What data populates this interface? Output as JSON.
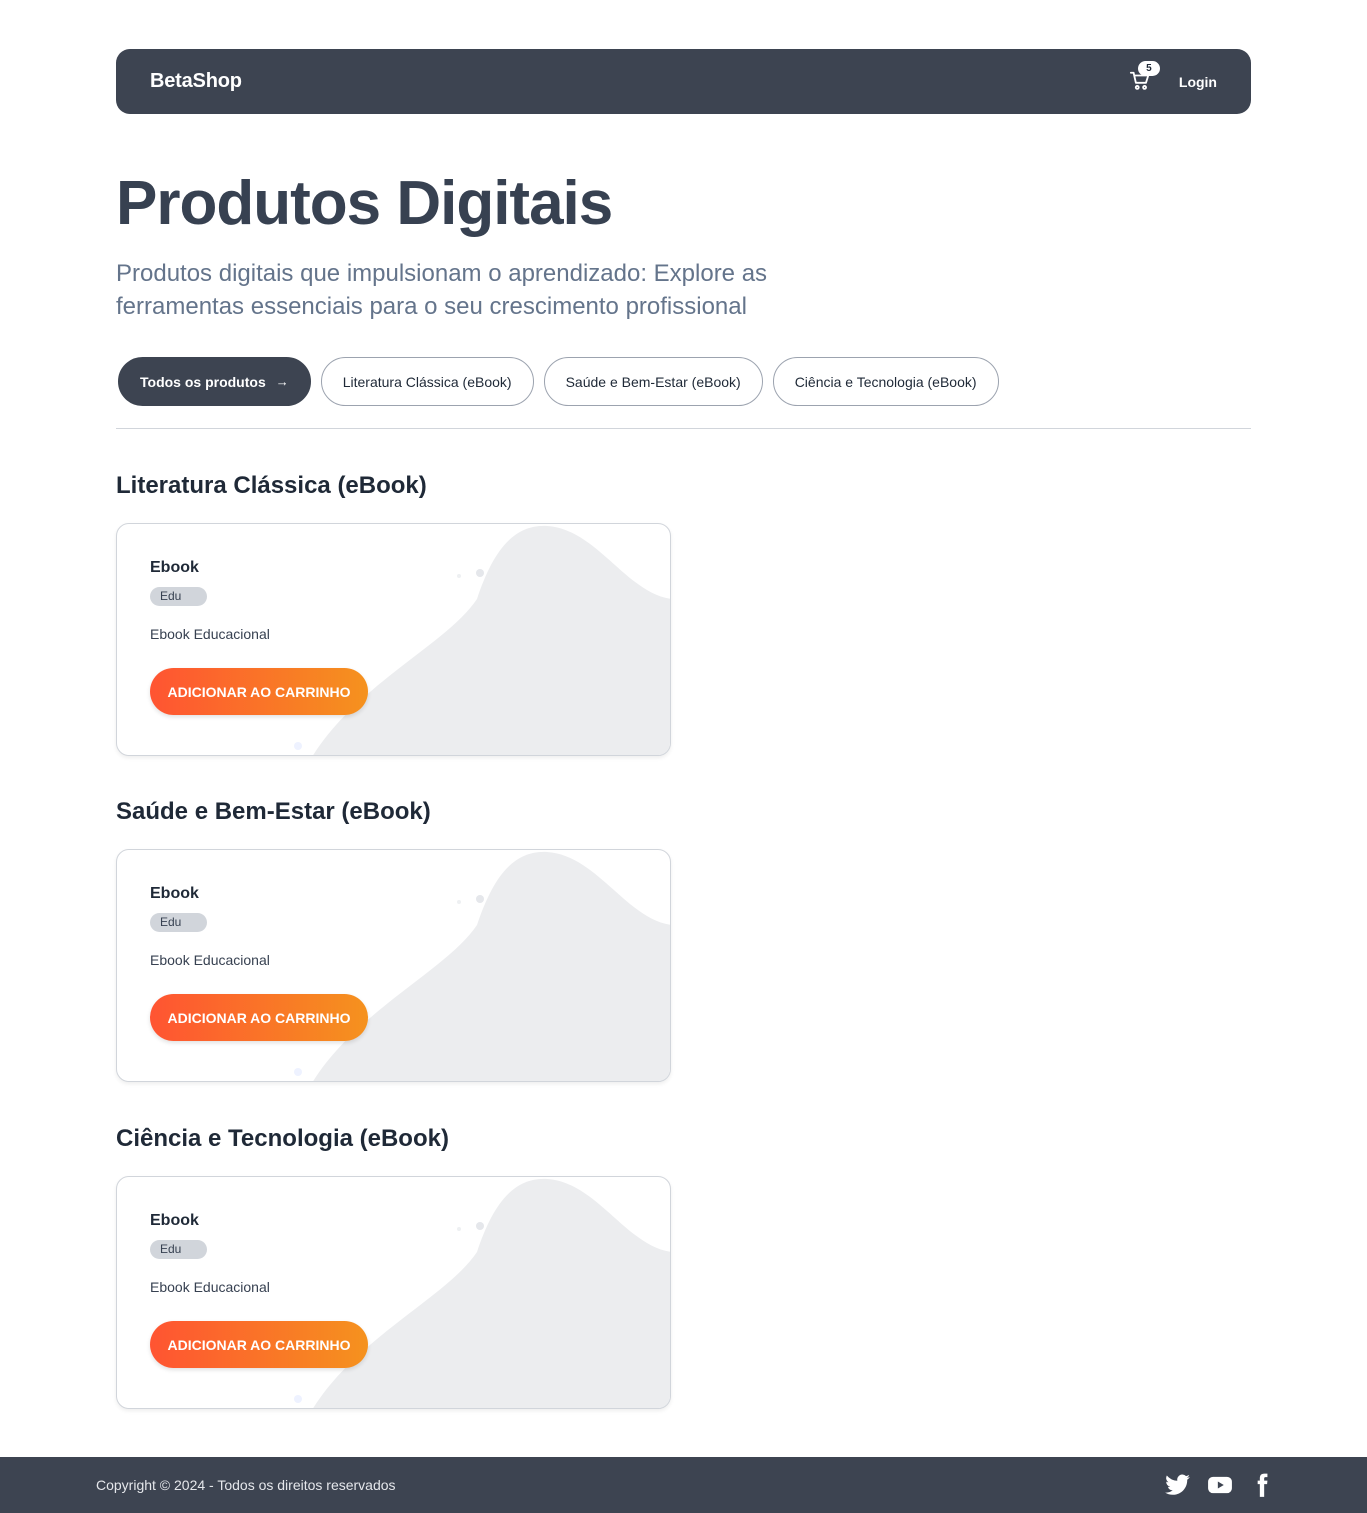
{
  "navbar": {
    "brand": "BetaShop",
    "cart_count": "5",
    "login_label": "Login"
  },
  "hero": {
    "title": "Produtos Digitais",
    "subtitle": "Produtos digitais que impulsionam o aprendizado: Explore as ferramentas essenciais para o seu crescimento profissional"
  },
  "filters": [
    {
      "label": "Todos os produtos",
      "arrow": "→",
      "active": true
    },
    {
      "label": "Literatura Clássica (eBook)",
      "active": false
    },
    {
      "label": "Saúde e Bem-Estar (eBook)",
      "active": false
    },
    {
      "label": "Ciência e Tecnologia (eBook)",
      "active": false
    }
  ],
  "sections": [
    {
      "title": "Literatura Clássica (eBook)",
      "card": {
        "title": "Ebook",
        "badge": "Edu",
        "description": "Ebook Educacional",
        "button": "ADICIONAR AO CARRINHO"
      }
    },
    {
      "title": "Saúde e Bem-Estar (eBook)",
      "card": {
        "title": "Ebook",
        "badge": "Edu",
        "description": "Ebook Educacional",
        "button": "ADICIONAR AO CARRINHO"
      }
    },
    {
      "title": "Ciência e Tecnologia (eBook)",
      "card": {
        "title": "Ebook",
        "badge": "Edu",
        "description": "Ebook Educacional",
        "button": "ADICIONAR AO CARRINHO"
      }
    }
  ],
  "footer": {
    "copyright": "Copyright © 2024 - Todos os direitos reservados",
    "social_icons": [
      "twitter-icon",
      "youtube-icon",
      "facebook-icon"
    ]
  },
  "colors": {
    "navbar": "#3d4451",
    "button_gradient_start": "#ff5432",
    "button_gradient_end": "#f5921e"
  }
}
